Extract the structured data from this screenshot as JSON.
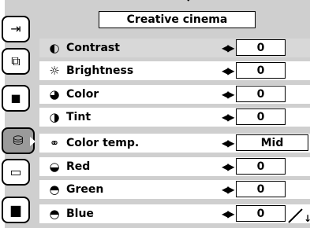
{
  "title": "Creative cinema",
  "sidebar": {
    "tabs": [
      {
        "icon": "input-icon",
        "glyph": "⇥"
      },
      {
        "icon": "screen-icon",
        "glyph": "⧉"
      },
      {
        "icon": "image-mode-icon",
        "glyph": "◼"
      },
      {
        "icon": "image-adjust-icon",
        "glyph": "⛁"
      },
      {
        "icon": "screen-adjust-icon",
        "glyph": "▭"
      },
      {
        "icon": "setting-icon",
        "glyph": "▆"
      }
    ]
  },
  "rows": [
    {
      "label": "Contrast",
      "value": "0",
      "icon": "contrast-icon",
      "glyph": "◐"
    },
    {
      "label": "Brightness",
      "value": "0",
      "icon": "brightness-icon",
      "glyph": "☼"
    },
    {
      "label": "Color",
      "value": "0",
      "icon": "color-icon",
      "glyph": "◕"
    },
    {
      "label": "Tint",
      "value": "0",
      "icon": "tint-icon",
      "glyph": "◑"
    },
    {
      "label": "Color temp.",
      "value": "Mid",
      "icon": "color-temp-icon",
      "glyph": "⚭"
    },
    {
      "label": "Red",
      "value": "0",
      "icon": "red-icon",
      "glyph": "◒"
    },
    {
      "label": "Green",
      "value": "0",
      "icon": "green-icon",
      "glyph": "◓"
    },
    {
      "label": "Blue",
      "value": "0",
      "icon": "blue-icon",
      "glyph": "◓"
    }
  ],
  "arrows_glyph": "◀▶",
  "scroll_down_glyph": "↓"
}
